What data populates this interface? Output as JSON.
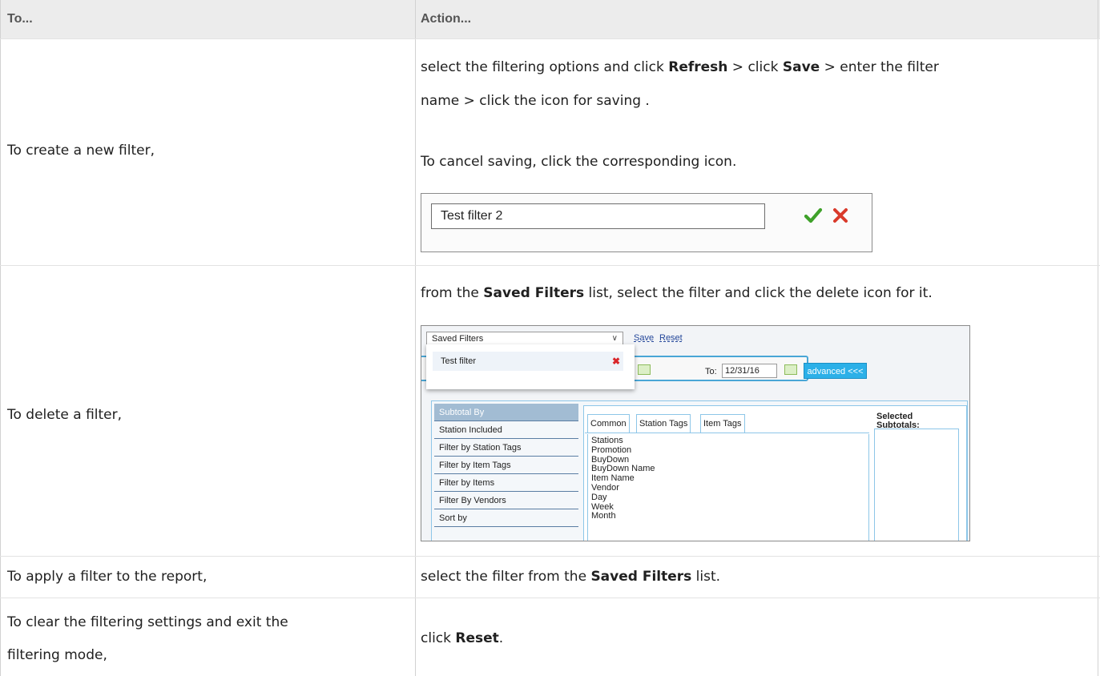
{
  "table": {
    "header": {
      "col1": "To...",
      "col2": "Action..."
    },
    "rows": [
      {
        "to": "To create a new filter,",
        "action_lines": [
          {
            "t1": "select the filtering options and click ",
            "b1": "Refresh",
            "t2": " > click ",
            "b2": "Save",
            "t3": " > enter the filter"
          },
          {
            "t1": "name > click the icon for saving ."
          },
          {
            "t1": "To cancel saving, click the corresponding icon."
          }
        ]
      },
      {
        "to": "To delete a filter,",
        "action": {
          "t1": "from the ",
          "b1": "Saved Filters",
          "t2": " list, select the filter and click the delete icon for it."
        }
      },
      {
        "to": "To apply a filter to the report,",
        "action": {
          "t1": "select the filter from the ",
          "b1": "Saved Filters",
          "t2": " list."
        }
      },
      {
        "to_lines": [
          "To clear the filtering settings and exit the",
          "filtering mode,"
        ],
        "action": {
          "t1": "click ",
          "b1": "Reset",
          "t2": "."
        }
      }
    ]
  },
  "shot_save": {
    "filter_name_value": "Test filter 2",
    "confirm_icon": "green-checkmark-icon",
    "cancel_icon": "red-x-icon",
    "colors": {
      "confirm": "#3fa12a",
      "cancel": "#d93a2b"
    }
  },
  "shot_filters": {
    "saved_filters_label": "Saved Filters",
    "save_link": "Save",
    "reset_link": "Reset",
    "dropdown_item": "Test filter",
    "to_label": "To:",
    "to_date": "12/31/16",
    "advanced_button": "advanced <<<",
    "sidebar_items": [
      "Subtotal By",
      "Station Included",
      "Filter by Station Tags",
      "Filter by Item Tags",
      "Filter by Items",
      "Filter By Vendors",
      "Sort by"
    ],
    "tabs": [
      "Common",
      "Station Tags",
      "Item Tags"
    ],
    "fields": [
      "Stations",
      "Promotion",
      "BuyDown",
      "BuyDown Name",
      "Item Name",
      "Vendor",
      "Day",
      "Week",
      "Month"
    ],
    "selected_heading_lines": [
      "Selected",
      "Subtotals:"
    ],
    "colors": {
      "accent": "#2cb0e8",
      "selected_side": "#a2bcd3",
      "delete": "#d9262a"
    }
  }
}
